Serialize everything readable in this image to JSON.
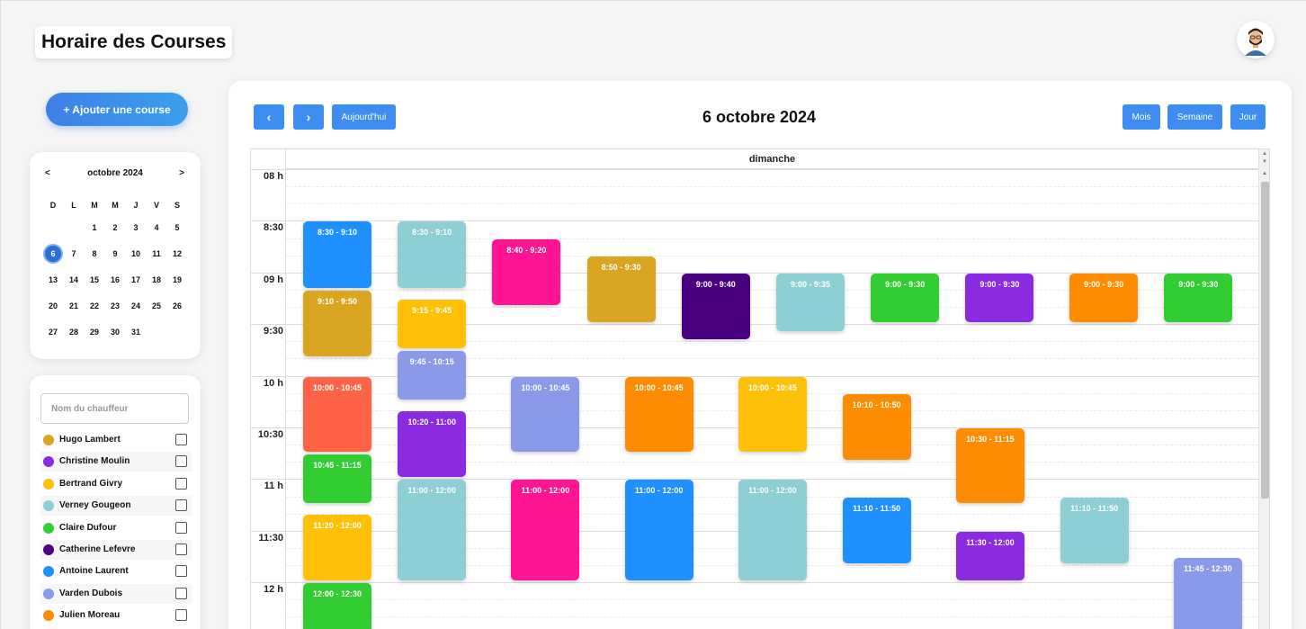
{
  "header": {
    "title": "Horaire des Courses",
    "avatar_icon": "user-avatar-icon"
  },
  "sidebar": {
    "add_button": "+ Ajouter une course",
    "mini_calendar": {
      "prev": "<",
      "next": ">",
      "month": "octobre 2024",
      "weekdays": [
        "D",
        "L",
        "M",
        "M",
        "J",
        "V",
        "S"
      ],
      "rows": [
        [
          "",
          "",
          "1",
          "2",
          "3",
          "4",
          "5"
        ],
        [
          "6",
          "7",
          "8",
          "9",
          "10",
          "11",
          "12"
        ],
        [
          "13",
          "14",
          "15",
          "16",
          "17",
          "18",
          "19"
        ],
        [
          "20",
          "21",
          "22",
          "23",
          "24",
          "25",
          "26"
        ],
        [
          "27",
          "28",
          "29",
          "30",
          "31",
          "",
          ""
        ]
      ],
      "selected": "6",
      "selected_color": "#2b6fd6"
    },
    "driver_search_placeholder": "Nom du chauffeur",
    "drivers": [
      {
        "name": "Hugo Lambert",
        "color": "#DAA520"
      },
      {
        "name": "Christine Moulin",
        "color": "#8A2BE2"
      },
      {
        "name": "Bertrand Givry",
        "color": "#FFC107"
      },
      {
        "name": "Verney Gougeon",
        "color": "#8ECFD6"
      },
      {
        "name": "Claire Dufour",
        "color": "#32CD32"
      },
      {
        "name": "Catherine Lefevre",
        "color": "#4B0082"
      },
      {
        "name": "Antoine Laurent",
        "color": "#1E90FF"
      },
      {
        "name": "Varden Dubois",
        "color": "#8A9AE8"
      },
      {
        "name": "Julien Moreau",
        "color": "#FF8C00"
      }
    ]
  },
  "calendar": {
    "prev_icon": "chevron-left-icon",
    "next_icon": "chevron-right-icon",
    "prev_label": "‹",
    "next_label": "›",
    "today_label": "Aujourd'hui",
    "title": "6 octobre 2024",
    "view_buttons": [
      "Mois",
      "Semaine",
      "Jour"
    ],
    "day_header": "dimanche",
    "time_labels": [
      "08 h",
      "8:30",
      "09 h",
      "9:30",
      "10 h",
      "10:30",
      "11 h",
      "11:30",
      "12 h"
    ],
    "events": [
      {
        "time": "8:30 - 9:10",
        "start": "8:30",
        "end": "9:10",
        "color": "#1E90FF",
        "col": 0
      },
      {
        "time": "9:10 - 9:50",
        "start": "9:10",
        "end": "9:50",
        "color": "#DAA520",
        "col": 0
      },
      {
        "time": "10:00 - 10:45",
        "start": "10:00",
        "end": "10:45",
        "color": "#FF6347",
        "col": 0
      },
      {
        "time": "10:45 - 11:15",
        "start": "10:45",
        "end": "11:15",
        "color": "#32CD32",
        "col": 0
      },
      {
        "time": "11:20 - 12:00",
        "start": "11:20",
        "end": "12:00",
        "color": "#FFC107",
        "col": 0
      },
      {
        "time": "12:00 - 12:30",
        "start": "12:00",
        "end": "12:30",
        "color": "#32CD32",
        "col": 0
      },
      {
        "time": "8:30 - 9:10",
        "start": "8:30",
        "end": "9:10",
        "color": "#8ECFD6",
        "col": 1
      },
      {
        "time": "9:15 - 9:45",
        "start": "9:15",
        "end": "9:45",
        "color": "#FFC107",
        "col": 1
      },
      {
        "time": "9:45 - 10:15",
        "start": "9:45",
        "end": "10:15",
        "color": "#8A9AE8",
        "col": 1
      },
      {
        "time": "10:20 - 11:00",
        "start": "10:20",
        "end": "11:00",
        "color": "#8A2BE2",
        "col": 1
      },
      {
        "time": "11:00 - 12:00",
        "start": "11:00",
        "end": "12:00",
        "color": "#8ECFD6",
        "col": 1
      },
      {
        "time": "8:40 - 9:20",
        "start": "8:40",
        "end": "9:20",
        "color": "#FF1493",
        "col": 2
      },
      {
        "time": "10:00 - 10:45",
        "start": "10:00",
        "end": "10:45",
        "color": "#8A9AE8",
        "col": 2.2
      },
      {
        "time": "11:00 - 12:00",
        "start": "11:00",
        "end": "12:00",
        "color": "#FF1493",
        "col": 2.2
      },
      {
        "time": "8:50 - 9:30",
        "start": "8:50",
        "end": "9:30",
        "color": "#DAA520",
        "col": 3
      },
      {
        "time": "10:00 - 10:45",
        "start": "10:00",
        "end": "10:45",
        "color": "#FF8C00",
        "col": 3.4
      },
      {
        "time": "11:00 - 12:00",
        "start": "11:00",
        "end": "12:00",
        "color": "#1E90FF",
        "col": 3.4
      },
      {
        "time": "9:00 - 9:40",
        "start": "9:00",
        "end": "9:40",
        "color": "#4B0082",
        "col": 4
      },
      {
        "time": "10:00 - 10:45",
        "start": "10:00",
        "end": "10:45",
        "color": "#FFC107",
        "col": 4.6
      },
      {
        "time": "11:00 - 12:00",
        "start": "11:00",
        "end": "12:00",
        "color": "#8ECFD6",
        "col": 4.6
      },
      {
        "time": "9:00 - 9:35",
        "start": "9:00",
        "end": "9:35",
        "color": "#8ECFD6",
        "col": 5
      },
      {
        "time": "10:10 - 10:50",
        "start": "10:10",
        "end": "10:50",
        "color": "#FF8C00",
        "col": 5.7
      },
      {
        "time": "11:10 - 11:50",
        "start": "11:10",
        "end": "11:50",
        "color": "#1E90FF",
        "col": 5.7
      },
      {
        "time": "9:00 - 9:30",
        "start": "9:00",
        "end": "9:30",
        "color": "#32CD32",
        "col": 6
      },
      {
        "time": "10:30 - 11:15",
        "start": "10:30",
        "end": "11:15",
        "color": "#FF8C00",
        "col": 6.9
      },
      {
        "time": "11:30 - 12:00",
        "start": "11:30",
        "end": "12:00",
        "color": "#8A2BE2",
        "col": 6.9
      },
      {
        "time": "9:00 - 9:30",
        "start": "9:00",
        "end": "9:30",
        "color": "#8A2BE2",
        "col": 7
      },
      {
        "time": "11:10 - 11:50",
        "start": "11:10",
        "end": "11:50",
        "color": "#8ECFD6",
        "col": 8
      },
      {
        "time": "9:00 - 9:30",
        "start": "9:00",
        "end": "9:30",
        "color": "#FF8C00",
        "col": 8.1
      },
      {
        "time": "11:45 - 12:30",
        "start": "11:45",
        "end": "12:30",
        "color": "#8A9AE8",
        "col": 9.2
      },
      {
        "time": "9:00 - 9:30",
        "start": "9:00",
        "end": "9:30",
        "color": "#32CD32",
        "col": 9.1
      }
    ]
  }
}
